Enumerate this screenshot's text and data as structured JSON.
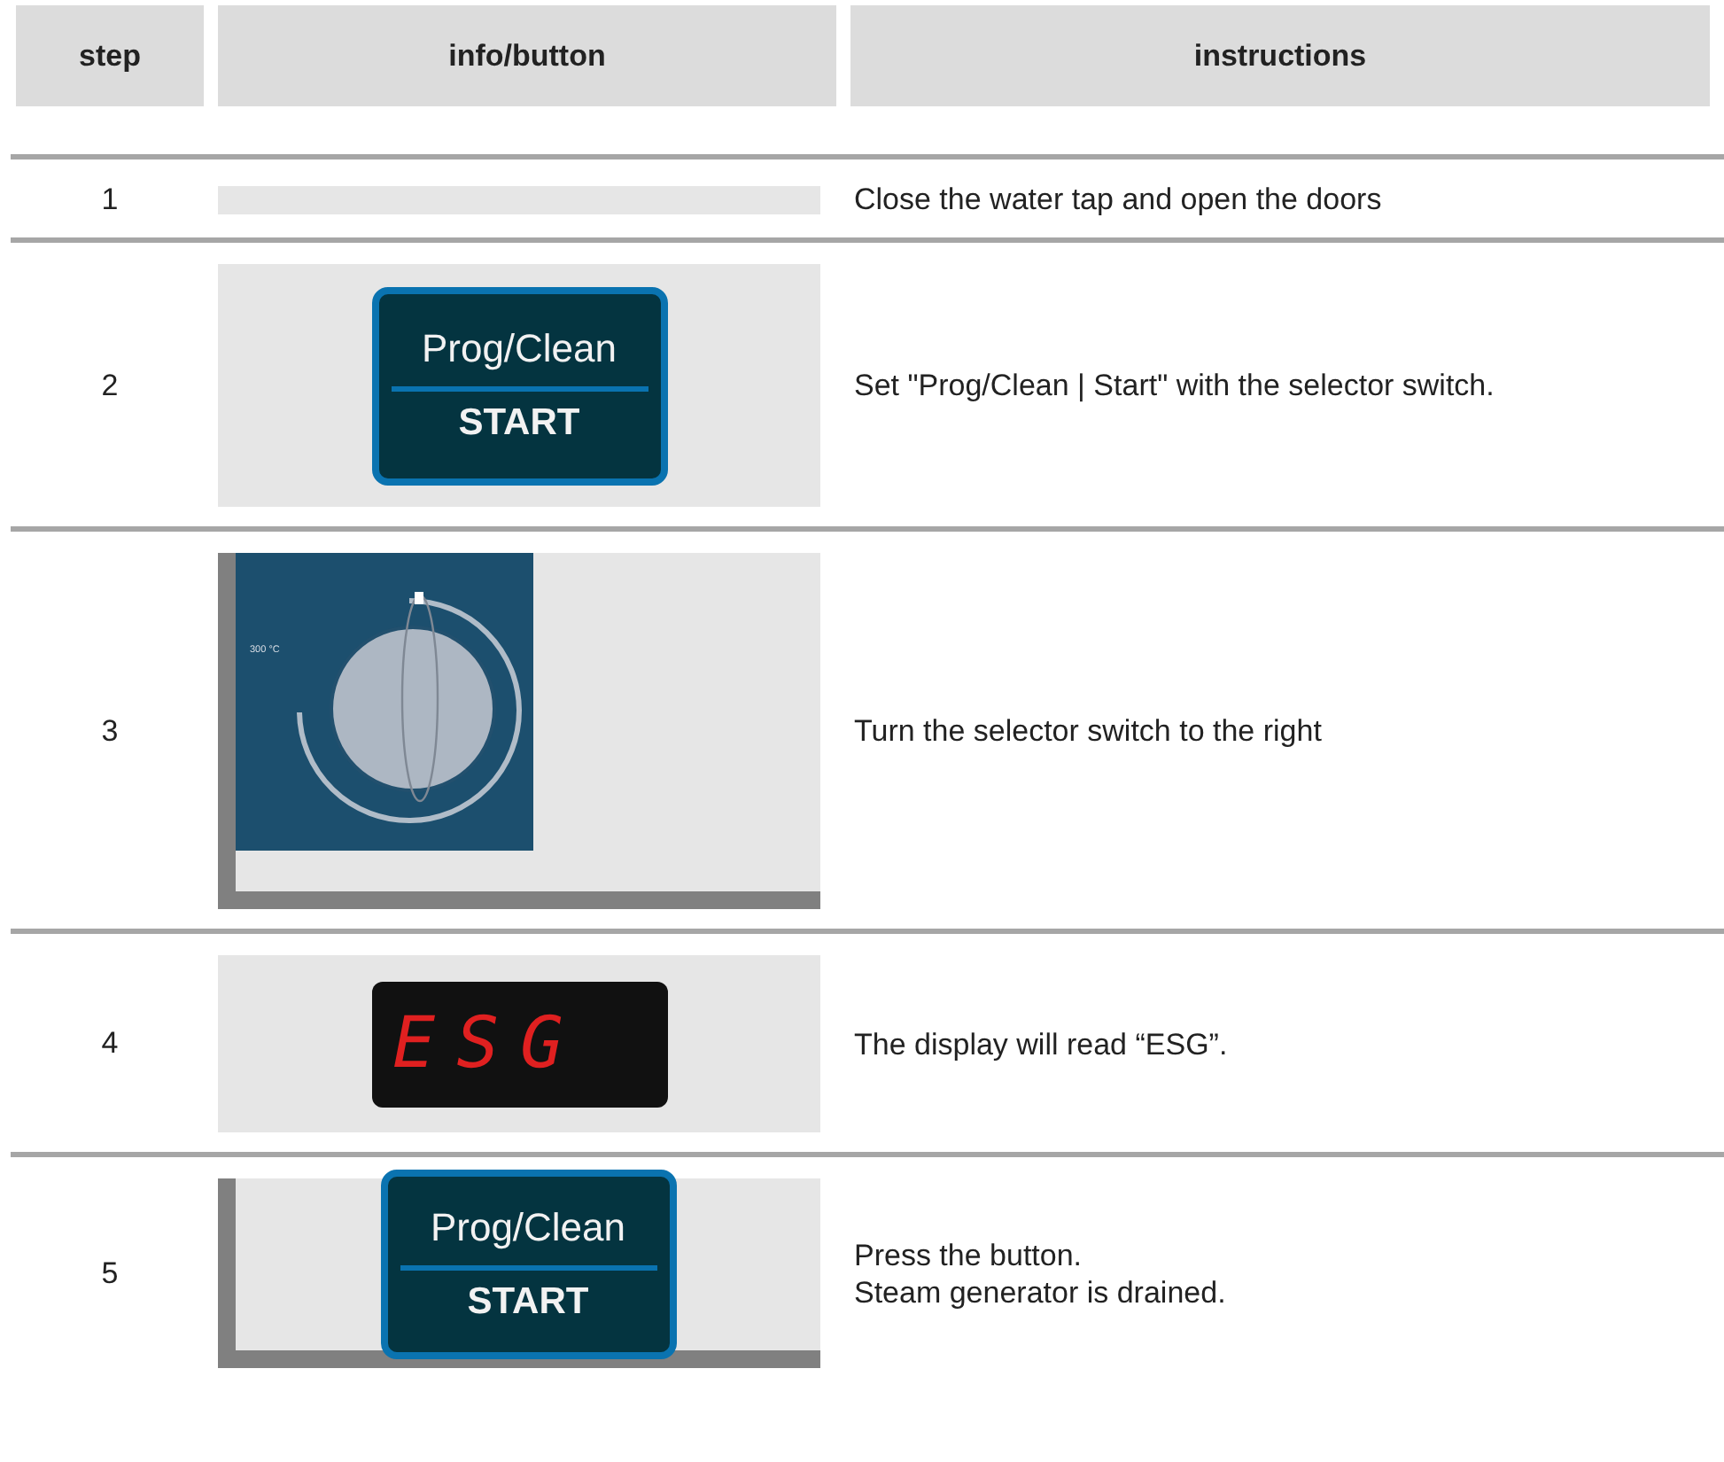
{
  "table": {
    "columns": [
      "step",
      "info/button",
      "instructions"
    ],
    "rows": [
      {
        "step": "1",
        "info": {
          "kind": "blank",
          "framed": false
        },
        "instructions": [
          "Close the water tap and open the doors"
        ]
      },
      {
        "step": "2",
        "info": {
          "kind": "button",
          "framed": false,
          "top": "Prog/Clean",
          "bottom": "START"
        },
        "instructions": [
          "Set \"Prog/Clean | Start\" with the selector switch."
        ]
      },
      {
        "step": "3",
        "info": {
          "kind": "dial",
          "framed": true,
          "label": "300 °C"
        },
        "instructions": [
          "Turn the selector switch to the right"
        ]
      },
      {
        "step": "4",
        "info": {
          "kind": "display",
          "framed": false,
          "text": "ESG"
        },
        "instructions": [
          "The display will read “ESG”."
        ]
      },
      {
        "step": "5",
        "info": {
          "kind": "button",
          "framed": true,
          "top": "Prog/Clean",
          "bottom": "START"
        },
        "instructions": [
          "Press the button.",
          "Steam generator is drained."
        ]
      }
    ]
  }
}
